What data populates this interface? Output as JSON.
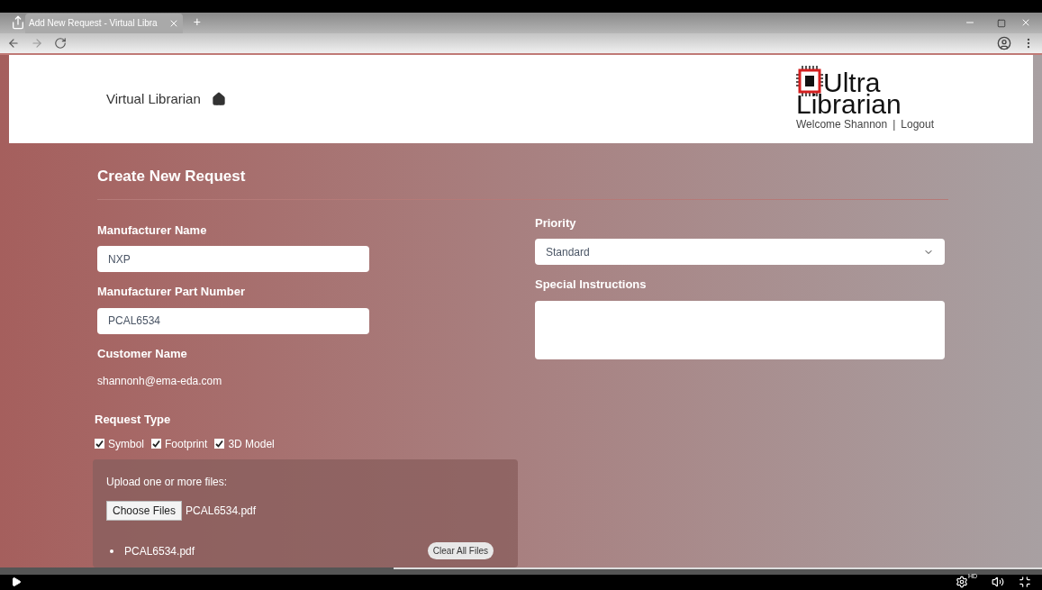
{
  "browser": {
    "tab_title": "Add New Request - Virtual Libra",
    "new_tab": "+"
  },
  "header": {
    "app_name": "Virtual Librarian",
    "logo": [
      "Ultra",
      "Librarian"
    ],
    "welcome": "Welcome Shannon",
    "separator": "|",
    "logout": "Logout"
  },
  "form": {
    "title": "Create New Request",
    "manufacturer_name": {
      "label": "Manufacturer Name",
      "value": "NXP"
    },
    "part_number": {
      "label": "Manufacturer Part Number",
      "value": "PCAL6534"
    },
    "customer": {
      "label": "Customer Name",
      "value": "shannonh@ema-eda.com"
    },
    "request_type": {
      "label": "Request Type",
      "options": [
        {
          "label": "Symbol",
          "checked": true
        },
        {
          "label": "Footprint",
          "checked": true
        },
        {
          "label": "3D Model",
          "checked": true
        }
      ]
    },
    "upload": {
      "label": "Upload one or more files:",
      "button": "Choose Files",
      "chosen": "PCAL6534.pdf",
      "files": [
        "PCAL6534.pdf"
      ],
      "clear": "Clear All Files"
    },
    "priority": {
      "label": "Priority",
      "value": "Standard"
    },
    "special_instructions": {
      "label": "Special Instructions"
    }
  },
  "player": {
    "hd": "HD"
  }
}
